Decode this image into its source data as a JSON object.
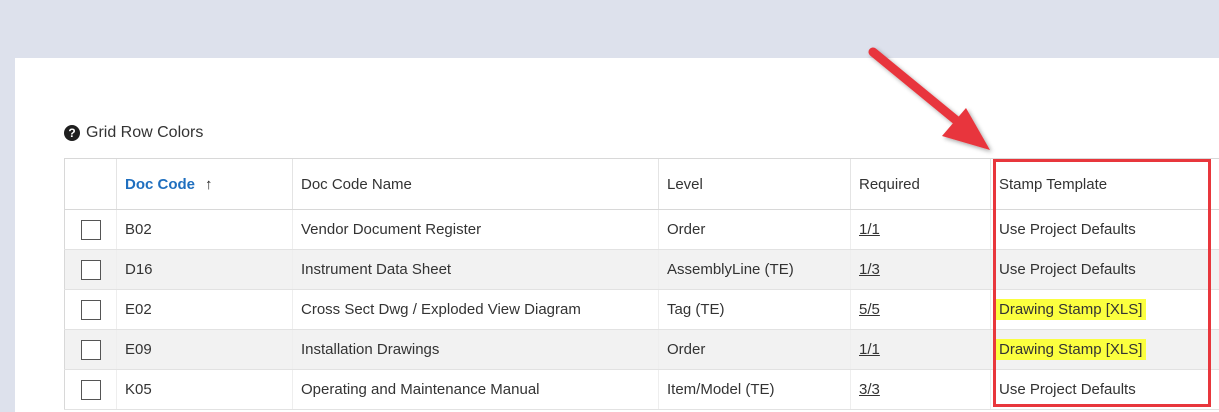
{
  "legend": {
    "label": "Grid Row Colors",
    "icon": "question-circle-icon"
  },
  "grid": {
    "columns": [
      {
        "key": "code",
        "label": "Doc Code",
        "sorted": "asc"
      },
      {
        "key": "name",
        "label": "Doc Code Name"
      },
      {
        "key": "level",
        "label": "Level"
      },
      {
        "key": "required",
        "label": "Required"
      },
      {
        "key": "stamp",
        "label": "Stamp Template"
      }
    ],
    "sort_arrow": "↑",
    "rows": [
      {
        "code": "B02",
        "name": "Vendor Document Register",
        "level": "Order",
        "required": "1/1",
        "stamp": "Use Project Defaults",
        "highlight": false
      },
      {
        "code": "D16",
        "name": "Instrument Data Sheet",
        "level": "AssemblyLine (TE)",
        "required": "1/3",
        "stamp": "Use Project Defaults",
        "highlight": false
      },
      {
        "code": "E02",
        "name": "Cross Sect Dwg / Exploded View Diagram",
        "level": "Tag (TE)",
        "required": "5/5",
        "stamp": "Drawing Stamp [XLS]",
        "highlight": true
      },
      {
        "code": "E09",
        "name": "Installation Drawings",
        "level": "Order",
        "required": "1/1",
        "stamp": "Drawing Stamp [XLS]",
        "highlight": true
      },
      {
        "code": "K05",
        "name": "Operating and Maintenance Manual",
        "level": "Item/Model (TE)",
        "required": "3/3",
        "stamp": "Use Project Defaults",
        "highlight": false
      }
    ]
  },
  "colors": {
    "background_band": "#dde1ec",
    "sorted_header": "#1f6fbf",
    "highlight": "#fbff3f",
    "annotation_red": "#e8363c"
  }
}
